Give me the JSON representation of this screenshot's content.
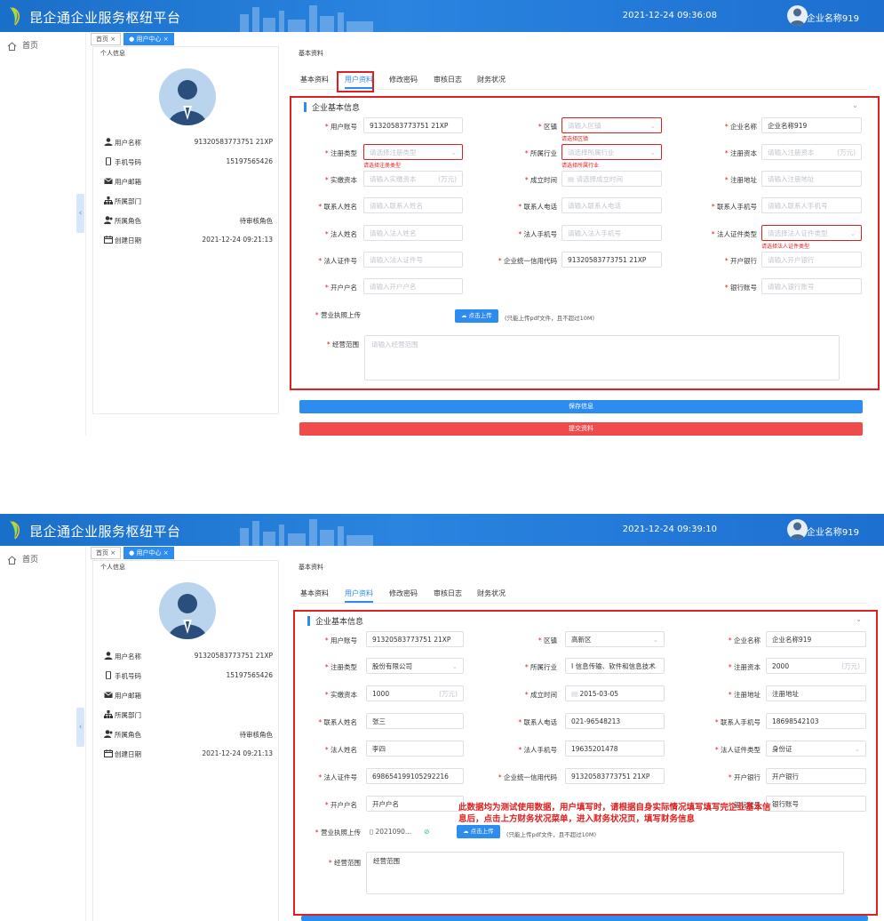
{
  "app": {
    "title": "昆企通企业服务枢纽平台",
    "user": "企业名称919",
    "time_top": "2021-12-24 09:36:08",
    "time_bottom": "2021-12-24 09:39:10"
  },
  "nav": {
    "home": "首页"
  },
  "breadcrumb": {
    "home": "首页",
    "home_close": "×",
    "current": "● 用户中心",
    "current_close": "×"
  },
  "profile": {
    "title": "个人信息",
    "rows": [
      {
        "label": "用户名称",
        "value": "91320583773751 21XP"
      },
      {
        "label": "手机号码",
        "value": "15197565426"
      },
      {
        "label": "用户邮箱",
        "value": ""
      },
      {
        "label": "所属部门",
        "value": ""
      },
      {
        "label": "所属角色",
        "value": "待审核角色"
      },
      {
        "label": "创建日期",
        "value": "2021-12-24 09:21:13"
      }
    ]
  },
  "main": {
    "title": "基本资料",
    "tabs": [
      "基本资料",
      "用户资料",
      "修改密码",
      "审核日志",
      "财务状况"
    ],
    "section_title": "企业基本信息"
  },
  "labels": {
    "account": "用户账号",
    "district": "区镇",
    "company": "企业名称",
    "reg_type": "注册类型",
    "industry": "所属行业",
    "reg_capital": "注册资本",
    "paid_capital": "实缴资本",
    "est_date": "成立时间",
    "reg_address": "注册地址",
    "contact_name": "联系人姓名",
    "contact_phone": "联系人电话",
    "contact_mobile": "联系人手机号",
    "legal_name": "法人姓名",
    "legal_mobile": "法人手机号",
    "legal_id_type": "法人证件类型",
    "legal_id_no": "法人证件号",
    "credit_code": "企业统一信用代码",
    "bank": "开户银行",
    "account_name": "开户户名",
    "bank_account": "银行账号",
    "license": "营业执照上传",
    "scope": "经营范围"
  },
  "placeholders": {
    "district": "请输入区镇",
    "company": "",
    "reg_type": "请选择注册类型",
    "industry": "请选择所属行业",
    "reg_capital": "请输入注册资本",
    "paid_capital": "请输入实缴资本",
    "est_date": "请选择成立时间",
    "reg_address": "请输入注册地址",
    "contact_name": "请输入联系人姓名",
    "contact_phone": "请输入联系人电话",
    "contact_mobile": "请输入联系人手机号",
    "legal_name": "请输入法人姓名",
    "legal_mobile": "请输入法人手机号",
    "legal_id_type": "请选择法人证件类型",
    "legal_id_no": "请输入法人证件号",
    "bank": "请输入开户银行",
    "account_name": "请输入开户户名",
    "bank_account": "请输入银行账号",
    "scope": "请输入经营范围"
  },
  "unit": "(万元)",
  "errors": {
    "district": "请选择区镇",
    "reg_type": "请选择注册类型",
    "industry": "请选择所属行业",
    "legal_id_type": "请选择法人证件类型"
  },
  "top_values": {
    "account": "91320583773751 21XP",
    "company": "企业名称919",
    "credit_code": "91320583773751 21XP"
  },
  "bottom_values": {
    "account": "91320583773751 21XP",
    "district": "高新区",
    "company": "企业名称919",
    "reg_type": "股份有限公司",
    "industry": "I 信息传输、软件和信息技术",
    "reg_capital": "2000",
    "paid_capital": "1000",
    "est_date": "2015-03-05",
    "reg_address": "注册地址",
    "contact_name": "张三",
    "contact_phone": "021-96548213",
    "contact_mobile": "18698542103",
    "legal_name": "李四",
    "legal_mobile": "19635201478",
    "legal_id_type": "身份证",
    "legal_id_no": "698654199105292216",
    "credit_code": "91320583773751 21XP",
    "bank": "开户银行",
    "account_name": "开户户名",
    "bank_account": "银行账号",
    "scope": "经营范围",
    "file": "2021090..."
  },
  "upload": {
    "button": "☁ 点击上传",
    "tip": "(只能上传pdf文件，且不超过10M)"
  },
  "buttons": {
    "save": "保存信息",
    "submit": "提交资料"
  },
  "notice": "此数据均为测试使用数据，用户填写时，请根据自身实际情况填写填写完企业基本信息后，点击上方财务状况菜单，进入财务状况页，填写财务信息",
  "colors": {
    "header": "#2a84e0",
    "primary": "#2d8cf0",
    "danger": "#e02020",
    "submit": "#f04a4a"
  }
}
